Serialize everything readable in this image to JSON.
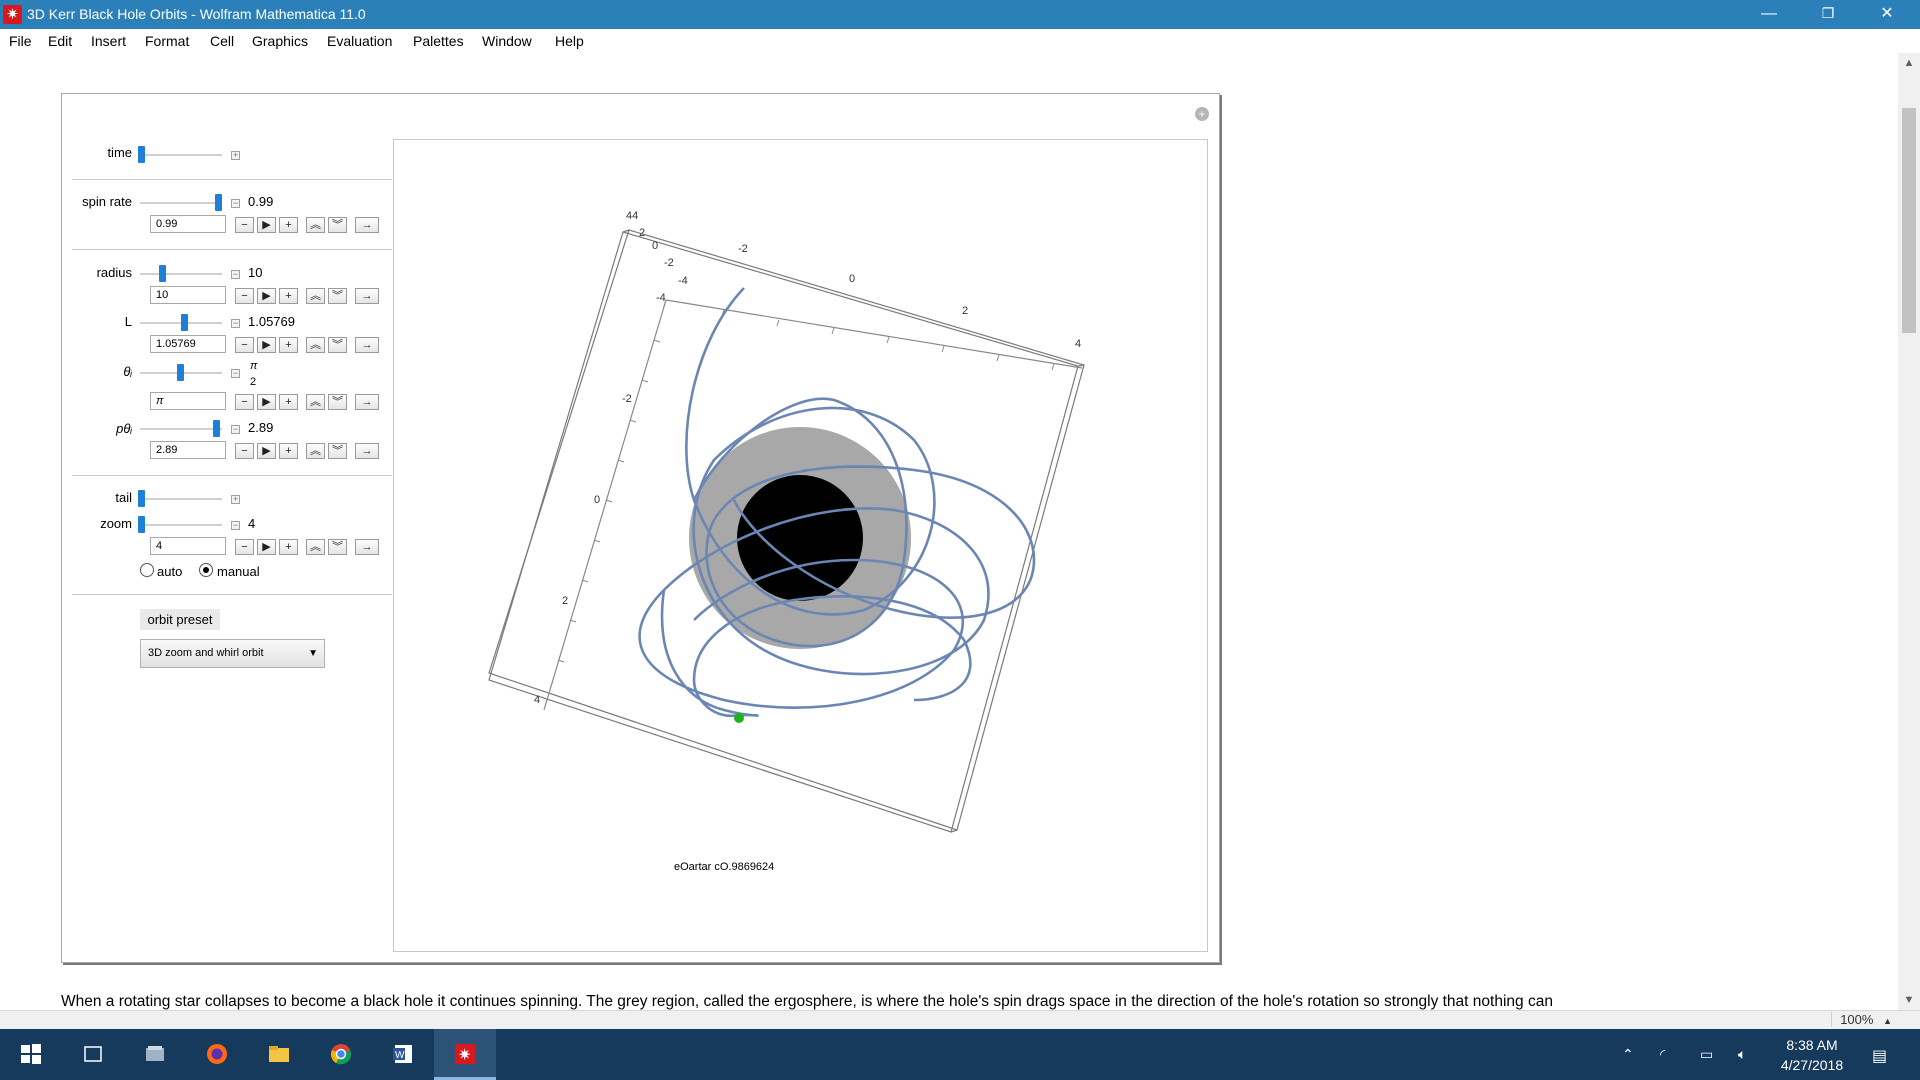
{
  "window": {
    "title": "3D Kerr Black Hole Orbits - Wolfram Mathematica 11.0",
    "minimize": "—",
    "restore": "❐",
    "close": "✕"
  },
  "menu": [
    "File",
    "Edit",
    "Insert",
    "Format",
    "Cell",
    "Graphics",
    "Evaluation",
    "Palettes",
    "Window",
    "Help"
  ],
  "controls": {
    "time": {
      "label": "time",
      "fraction": 0.0
    },
    "spin_rate": {
      "label": "spin rate",
      "value": "0.99",
      "fraction": 0.99
    },
    "radius": {
      "label": "radius",
      "value": "10",
      "fraction": 0.27
    },
    "L": {
      "label": "L",
      "value": "1.05769",
      "fraction": 0.55
    },
    "theta": {
      "label": "θᵢ",
      "value_num": "π",
      "value_den": "2",
      "fraction": 0.5
    },
    "p_theta": {
      "label": "pθᵢ",
      "value": "2.89",
      "fraction": 0.96
    },
    "tail": {
      "label": "tail",
      "fraction": 0.0
    },
    "zoom": {
      "label": "zoom",
      "value": "4",
      "fraction": 0.0
    }
  },
  "zoom_mode": {
    "auto": "auto",
    "manual": "manual",
    "selected": "manual"
  },
  "preset": {
    "label": "orbit preset",
    "selected": "3D zoom and whirl orbit"
  },
  "plot": {
    "top_axis_ticks": [
      "-2",
      "0",
      "2",
      "4"
    ],
    "left_axis_ticks": [
      "-2",
      "0",
      "2"
    ],
    "corner_labels": [
      "44",
      "2",
      "0",
      "-2",
      "-4",
      "-4",
      "4"
    ],
    "overlay_text": "eOartar cO.9869624",
    "ergosphere_color": "#a8a8a8",
    "horizon_color": "#000000",
    "orbit_color": "#6b86b3",
    "particle_color": "#1db31d"
  },
  "caption": "When a rotating star collapses to become a black hole it continues spinning. The grey region, called the ergosphere, is where the hole's spin drags space in the direction of the hole's rotation so strongly that nothing can",
  "status": {
    "zoom": "100%"
  },
  "taskbar": {
    "apps": [
      "start",
      "task-view",
      "file-manager",
      "firefox",
      "file-explorer",
      "chrome",
      "word",
      "mathematica"
    ],
    "time": "8:38 AM",
    "date": "4/27/2018"
  }
}
